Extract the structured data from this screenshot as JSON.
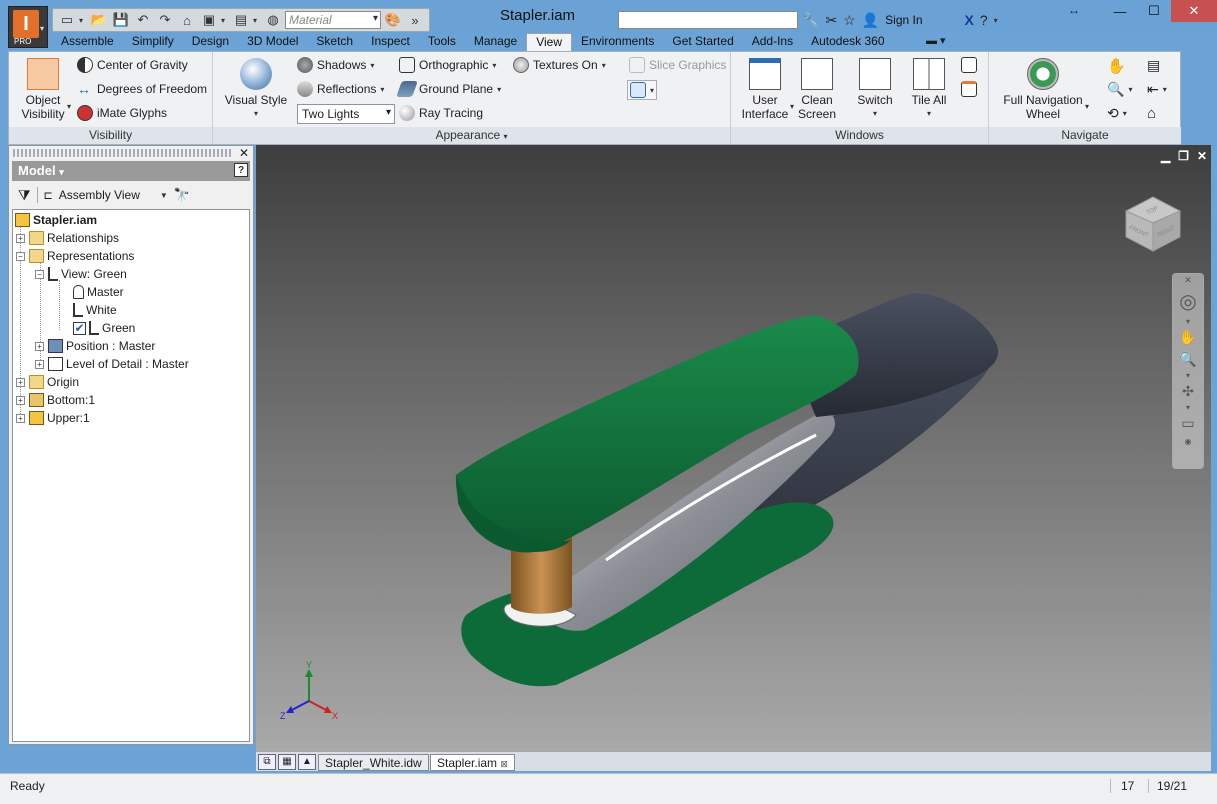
{
  "window": {
    "title": "Stapler.iam"
  },
  "app": {
    "badge": "PRO",
    "logo": "I"
  },
  "qat": {
    "material_placeholder": "Material"
  },
  "titlebar": {
    "sign_in": "Sign In"
  },
  "tabs": [
    "Assemble",
    "Simplify",
    "Design",
    "3D Model",
    "Sketch",
    "Inspect",
    "Tools",
    "Manage",
    "View",
    "Environments",
    "Get Started",
    "Add-Ins",
    "Autodesk 360"
  ],
  "active_tab": "View",
  "ribbon": {
    "visibility": {
      "label": "Visibility",
      "object_visibility_1": "Object",
      "object_visibility_2": "Visibility",
      "center_of_gravity": "Center of Gravity",
      "degrees_of_freedom": "Degrees of Freedom",
      "imate_glyphs": "iMate Glyphs"
    },
    "appearance": {
      "label": "Appearance",
      "visual_style": "Visual Style",
      "shadows": "Shadows",
      "reflections": "Reflections",
      "lighting": "Two Lights",
      "orthographic": "Orthographic",
      "ground_plane": "Ground Plane",
      "ray_tracing": "Ray Tracing",
      "textures_on": "Textures On",
      "slice_graphics": "Slice Graphics"
    },
    "windows": {
      "label": "Windows",
      "user_interface_1": "User",
      "user_interface_2": "Interface",
      "clean_screen_1": "Clean",
      "clean_screen_2": "Screen",
      "switch": "Switch",
      "tile_all": "Tile All"
    },
    "navigate": {
      "label": "Navigate",
      "full_nav_1": "Full Navigation",
      "full_nav_2": "Wheel"
    }
  },
  "browser": {
    "title": "Model",
    "view_select": "Assembly View",
    "help": "?",
    "tree": {
      "root": "Stapler.iam",
      "relationships": "Relationships",
      "representations": "Representations",
      "view": "View: Green",
      "master": "Master",
      "white": "White",
      "green": "Green",
      "position": "Position : Master",
      "lod": "Level of Detail : Master",
      "origin": "Origin",
      "bottom": "Bottom:1",
      "upper": "Upper:1"
    }
  },
  "viewcube": {
    "top": "TOP",
    "front": "FRONT",
    "right": "RIGHT"
  },
  "triad": {
    "x": "X",
    "y": "Y",
    "z": "Z"
  },
  "doc_tabs": [
    "Stapler_White.idw",
    "Stapler.iam"
  ],
  "status": {
    "text": "Ready",
    "count1": "17",
    "count2": "19/21"
  },
  "colors": {
    "accent": "#6aa2d6",
    "stapler_green": "#0e6b3a",
    "stapler_dark": "#2f3440",
    "brass": "#b07a3c"
  }
}
